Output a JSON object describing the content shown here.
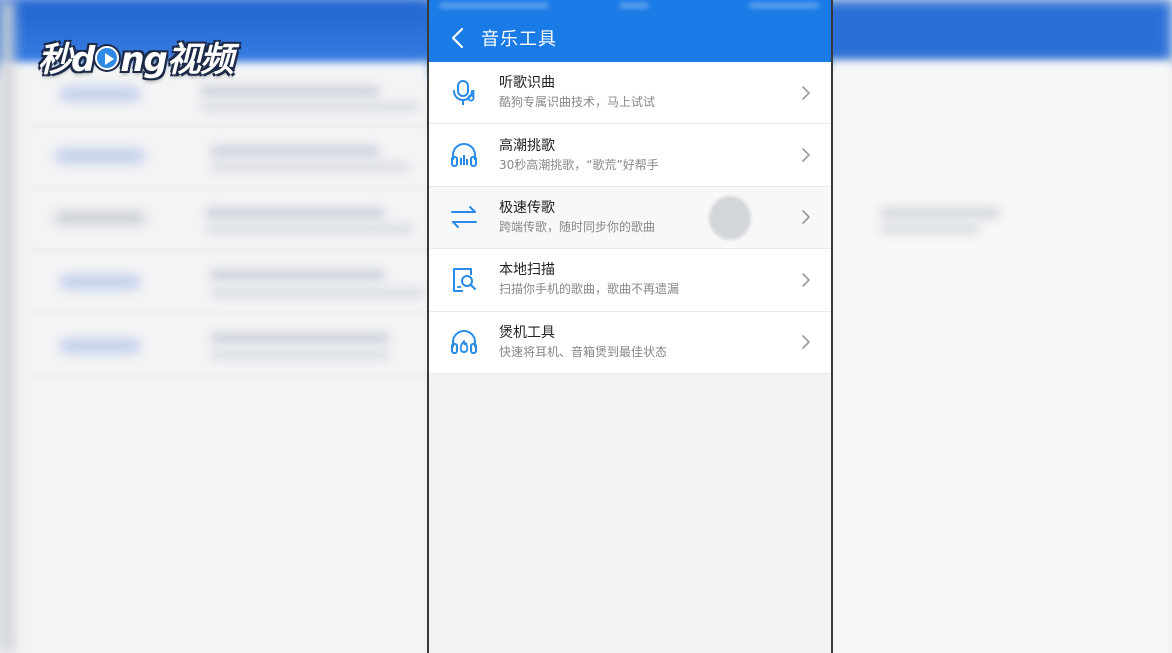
{
  "watermark": {
    "text_left": "秒d",
    "text_right": "ng视频"
  },
  "header": {
    "title": "音乐工具"
  },
  "tools": [
    {
      "title": "听歌识曲",
      "subtitle": "酷狗专属识曲技术，马上试试",
      "icon": "mic-note-icon"
    },
    {
      "title": "高潮挑歌",
      "subtitle": "30秒高潮挑歌，“歌荒”好帮手",
      "icon": "headphones-bars-icon"
    },
    {
      "title": "极速传歌",
      "subtitle": "跨端传歌，随时同步你的歌曲",
      "icon": "transfer-arrows-icon"
    },
    {
      "title": "本地扫描",
      "subtitle": "扫描你手机的歌曲，歌曲不再遗漏",
      "icon": "scan-search-icon"
    },
    {
      "title": "煲机工具",
      "subtitle": "快速将耳机、音箱煲到最佳状态",
      "icon": "headphones-flame-icon"
    }
  ],
  "colors": {
    "accent": "#1a7be6",
    "icon": "#2a8ae8",
    "chevron": "#9a9a9a"
  }
}
